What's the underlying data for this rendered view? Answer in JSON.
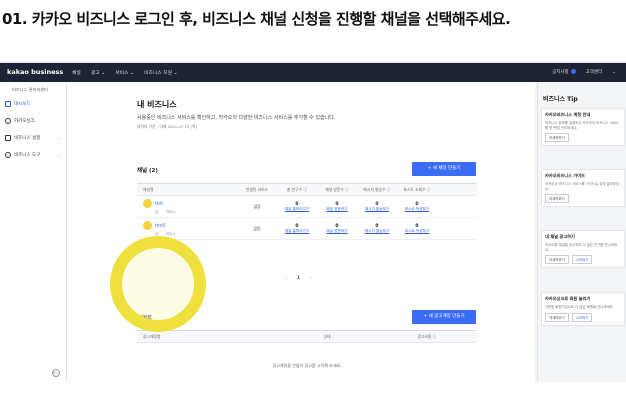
{
  "caption": "01. 카카오 비즈니스 로그인 후, 비즈니스 채널 신청을 진행할 채널을 선택해주세요.",
  "topbar": {
    "brand": "kakao business",
    "nav": [
      "채널",
      "광고 ⌄",
      "서비스 ⌄",
      "비즈니스 지원 ⌄"
    ],
    "right": [
      "공지사항",
      "고객센터",
      "⌄"
    ]
  },
  "sidebar": {
    "title": "비즈니스 관리자센터",
    "items": [
      {
        "label": "대시보드",
        "icon": "dashboard-icon"
      },
      {
        "label": "카카오싱크",
        "icon": "link-icon"
      },
      {
        "label": "비즈니스 설정",
        "icon": "settings-icon"
      },
      {
        "label": "비즈니스 도구",
        "icon": "tools-icon"
      }
    ],
    "collapse": "⟵"
  },
  "main": {
    "title": "내 비즈니스",
    "desc": "사용중인 비즈니스 서비스를 확인하고, 카카오의 다양한 비즈니스 서비스를 추가할 수 있습니다.",
    "date": "데이터 기준 : 어제 2021.07.15 (목)",
    "channel_section": {
      "label": "채널 (2)",
      "button": "+ 새 채널 만들기",
      "headers": [
        "채널명",
        "연결된 서비스",
        "총 친구수 ⓘ",
        "채널 방문수 ⓘ",
        "메시지 발송수 ⓘ",
        "포스트 조회수 ⓘ"
      ],
      "rows": [
        {
          "name": "test",
          "sub_left": "@",
          "sub_right": "파트너",
          "service": "없음",
          "cols": [
            {
              "num": "0",
              "link": "채널 홈보러가기"
            },
            {
              "num": "0",
              "link": "채널 방문하기"
            },
            {
              "num": "0",
              "link": "메시지 발송하기"
            },
            {
              "num": "0",
              "link": "포스트 작성하기"
            }
          ]
        },
        {
          "name": "test2",
          "sub_left": "@",
          "sub_right": "파트너",
          "service": "없음",
          "cols": [
            {
              "num": "0",
              "link": "채널 홈보러가기"
            },
            {
              "num": "0",
              "link": "채널 방문하기"
            },
            {
              "num": "0",
              "link": "메시지 발송하기"
            },
            {
              "num": "0",
              "link": "포스트 작성하기"
            }
          ]
        }
      ],
      "page": "1",
      "prev": "‹",
      "next": "›"
    },
    "moment_section": {
      "label": "모먼트",
      "button": "+ 새 광고계정 만들기",
      "headers": [
        "광고계정명",
        "상태",
        "광고비용 ⓘ"
      ],
      "empty": "광고계정을 만들어 광고를 시작해 보세요."
    }
  },
  "tips": {
    "title": "비즈니스 Tip",
    "cards": [
      {
        "title": "카카오비즈니스 계정 안내",
        "body": "비즈니스 정보를 설정하고 카카오의 비즈니스 서비스를 한 번에 관리하세요.",
        "buttons": [
          "자세히보기"
        ]
      },
      {
        "title": "카카오비즈니스 가이드",
        "body": "카카오의 비즈니스 서비스를 가이드로 쉽게 알아보세요.",
        "buttons": [
          "자세히보기"
        ]
      },
      {
        "title": "내 채널 광고하기",
        "body": "카카오톡 채널을 광고하여 더 많은 친구를 만나보세요.",
        "buttons": [
          "자세히보기",
          "시작하기"
        ]
      },
      {
        "title": "카카오싱크로 회원 늘리기",
        "body": "간편한 회원가입으로 더 많은 회원을 만나보세요.",
        "buttons": [
          "자세히보기",
          "시작하기"
        ]
      }
    ]
  },
  "colors": {
    "accent": "#3a6cf4",
    "topbar": "#1d2333",
    "highlight": "#efe03d"
  }
}
